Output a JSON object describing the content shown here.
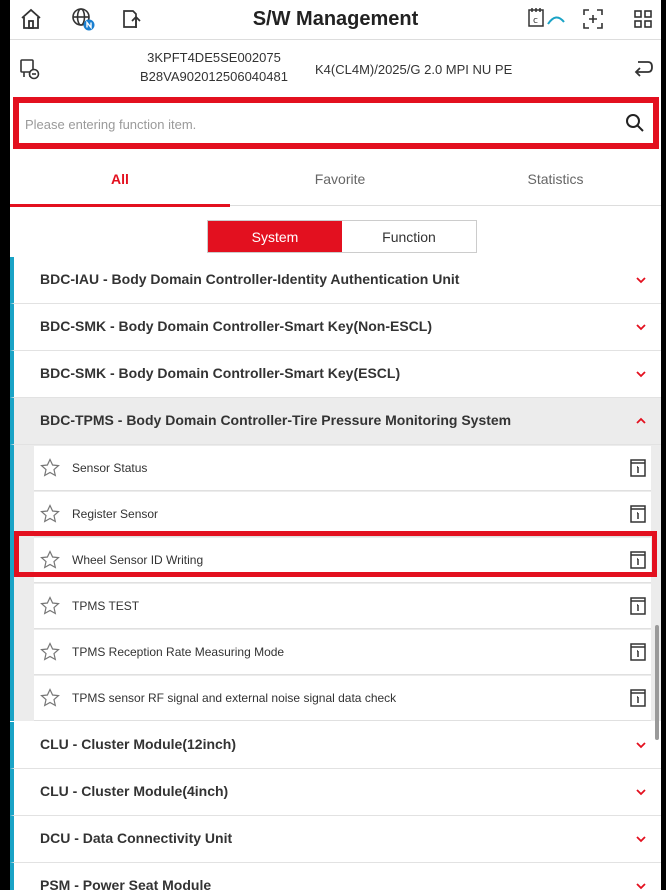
{
  "header": {
    "title": "S/W Management"
  },
  "vehicle": {
    "vin": "3KPFT4DE5SE002075",
    "code": "B28VA902012506040481",
    "model": "K4(CL4M)/2025/G 2.0 MPI NU PE"
  },
  "search": {
    "placeholder": "Please entering function item.",
    "value": ""
  },
  "tabs": [
    {
      "label": "All",
      "active": true
    },
    {
      "label": "Favorite",
      "active": false
    },
    {
      "label": "Statistics",
      "active": false
    }
  ],
  "segment": {
    "left": "System",
    "right": "Function",
    "selected": "System"
  },
  "systems": [
    {
      "label": "BDC-IAU - Body Domain Controller-Identity Authentication Unit",
      "expanded": false
    },
    {
      "label": "BDC-SMK - Body Domain Controller-Smart Key(Non-ESCL)",
      "expanded": false
    },
    {
      "label": "BDC-SMK - Body Domain Controller-Smart Key(ESCL)",
      "expanded": false
    },
    {
      "label": "BDC-TPMS - Body Domain Controller-Tire Pressure Monitoring System",
      "expanded": true,
      "functions": [
        "Sensor Status",
        "Register Sensor",
        "Wheel Sensor ID Writing",
        "TPMS TEST",
        "TPMS Reception Rate Measuring Mode",
        "TPMS sensor RF signal and external noise signal data check"
      ]
    },
    {
      "label": "CLU - Cluster Module(12inch)",
      "expanded": false
    },
    {
      "label": "CLU - Cluster Module(4inch)",
      "expanded": false
    },
    {
      "label": "DCU - Data Connectivity Unit",
      "expanded": false
    },
    {
      "label": "PSM - Power Seat Module",
      "expanded": false
    }
  ],
  "highlighted_function": "Wheel Sensor ID Writing",
  "colors": {
    "accent": "#e3101f",
    "system_marker": "#1aa3c6"
  },
  "icons": [
    "home-icon",
    "globe-network-icon",
    "upload-icon",
    "connection-icon",
    "screen-capture-icon",
    "grid-menu-icon",
    "vehicle-link-icon",
    "back-return-icon",
    "search-icon",
    "star-icon",
    "info-book-icon",
    "chevron-down-icon",
    "chevron-up-icon"
  ]
}
